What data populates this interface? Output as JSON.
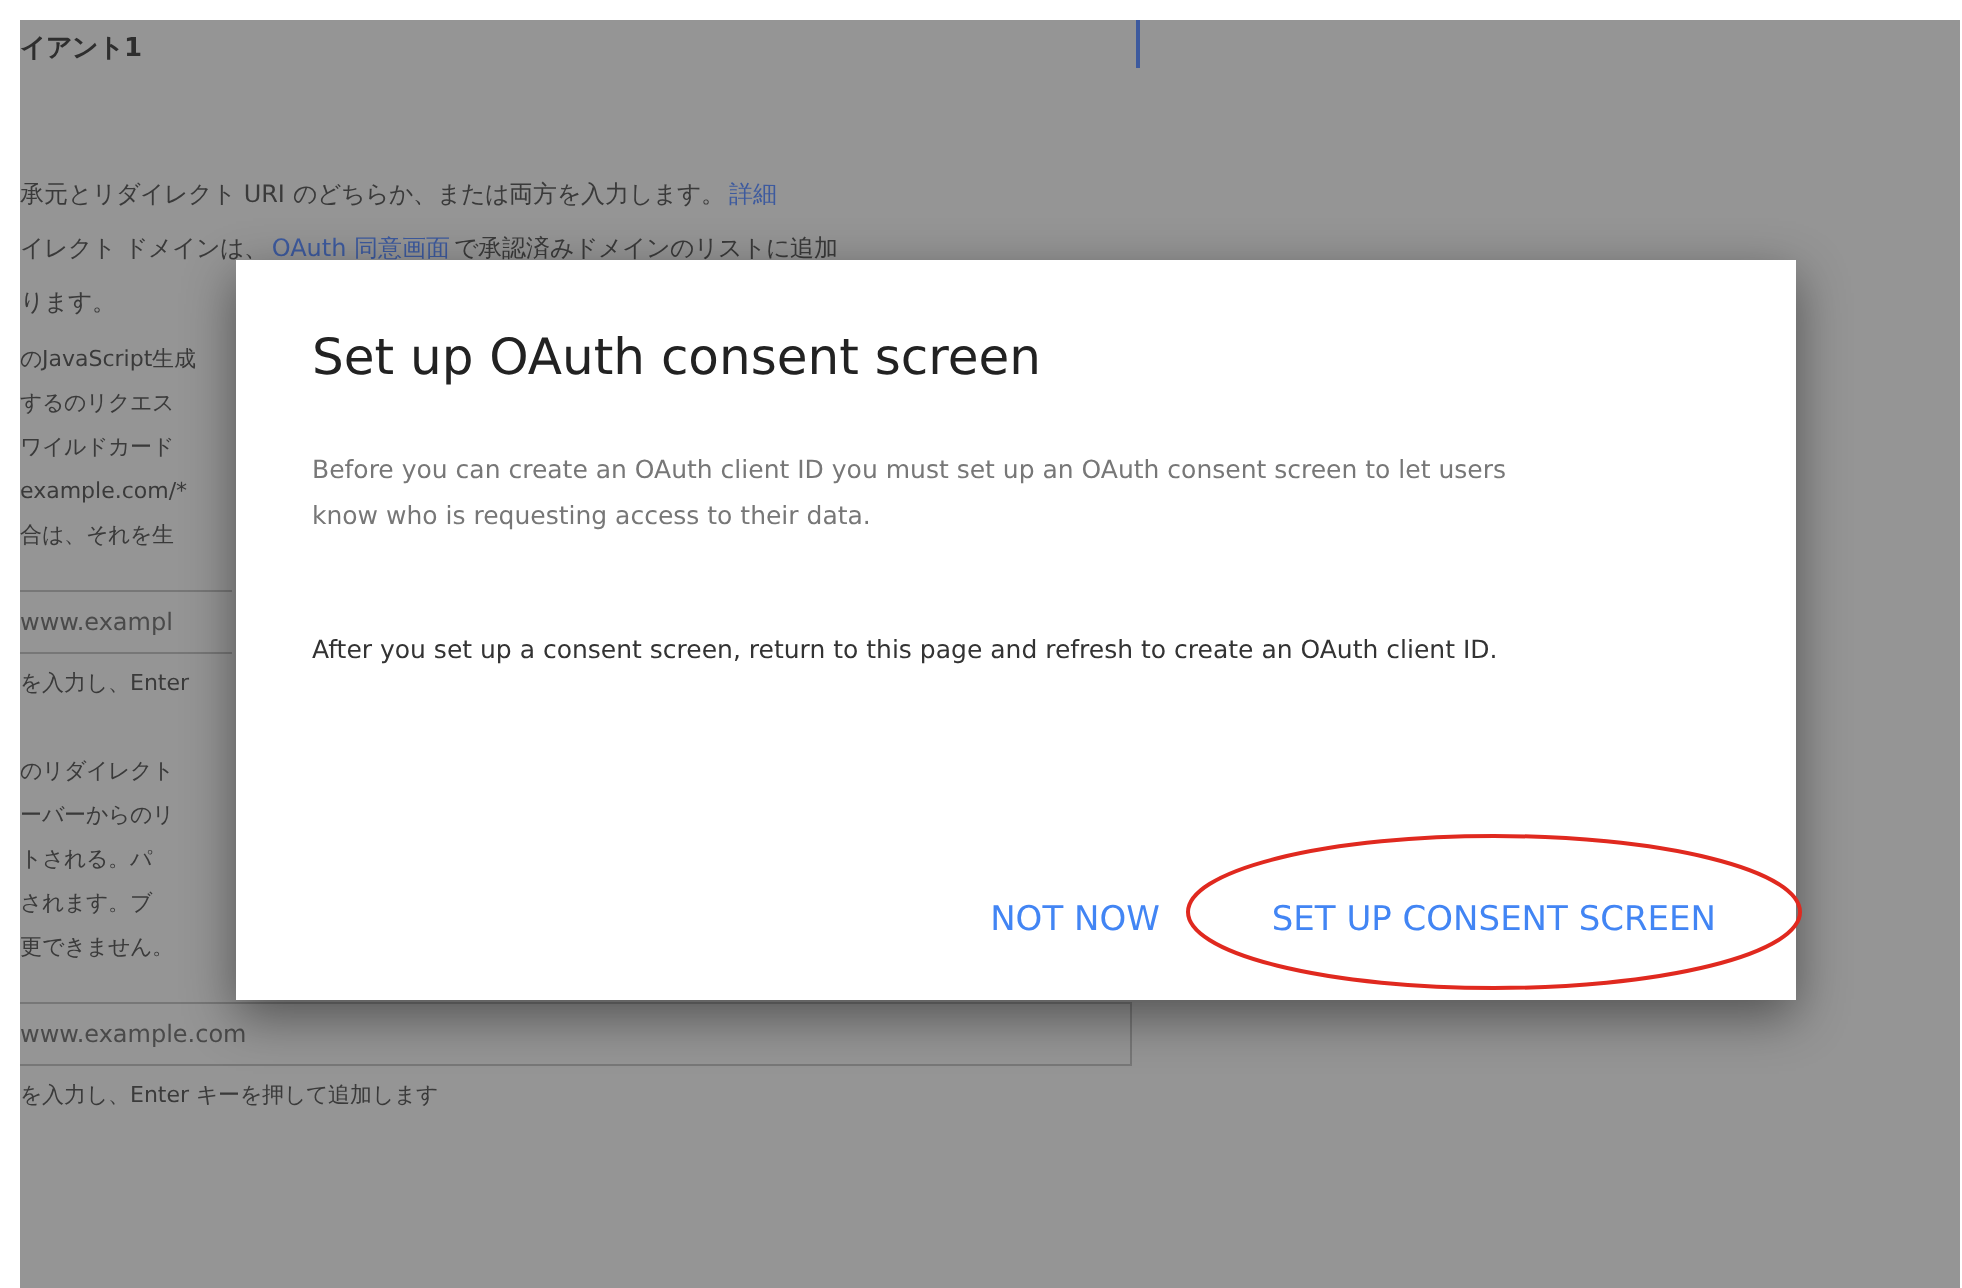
{
  "background": {
    "heading": "イアント1",
    "intro": [
      {
        "text": "承元とリダイレクト URI のどちらか、または両方を入力します。",
        "link": "詳細"
      },
      {
        "text": "イレクト ドメインは、",
        "link": "OAuth 同意画面",
        "after": "で承認済みドメインのリストに追加"
      },
      {
        "text": "ります。"
      }
    ],
    "origins": {
      "lines": [
        "のJavaScript生成",
        "するのリクエス",
        "ワイルドカード",
        "example.com/*",
        "合は、それを生"
      ],
      "field_value": "www.exampl",
      "hint": "を入力し、Enter"
    },
    "redirects": {
      "lines": [
        "のリダイレクト",
        "ーバーからのリ",
        "トされる。パ",
        "されます。ブ",
        "更できません。"
      ],
      "field_value": "www.example.com",
      "hint": "を入力し、Enter キーを押して追加します"
    }
  },
  "dialog": {
    "title": "Set up OAuth consent screen",
    "paragraphs": [
      {
        "text": "Before you can create an OAuth client ID you must set up an OAuth consent screen to let users know who is requesting access to their data.",
        "muted": true
      },
      {
        "text": "After you set up a consent screen, return to this page and refresh to create an OAuth client ID.",
        "muted": false
      }
    ],
    "buttons": [
      {
        "label": "NOT NOW",
        "highlighted": false
      },
      {
        "label": "SET UP CONSENT SCREEN",
        "highlighted": true
      }
    ]
  }
}
